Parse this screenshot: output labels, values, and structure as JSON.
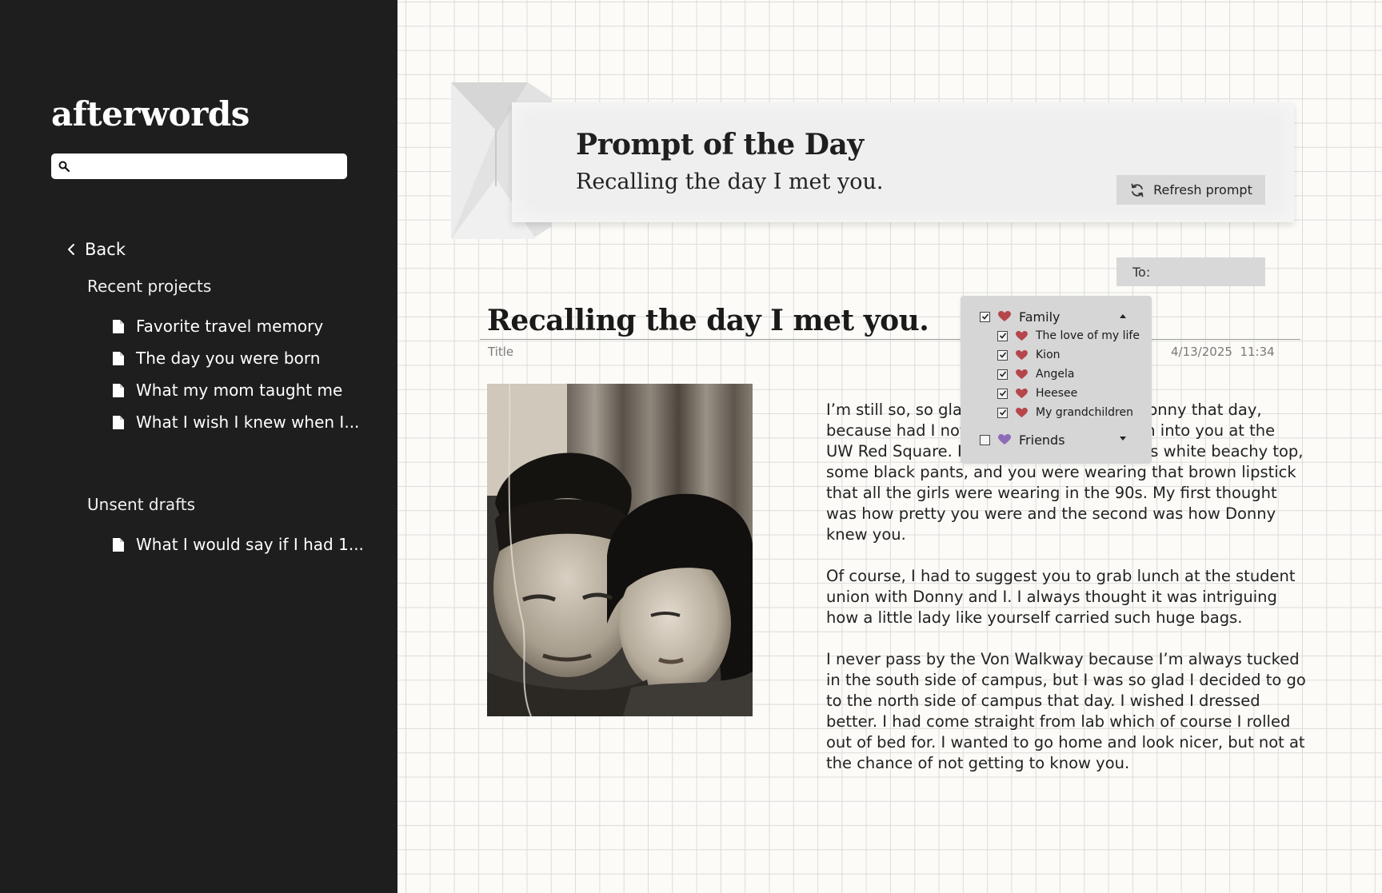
{
  "app": {
    "name": "afterwords"
  },
  "sidebar": {
    "search_placeholder": "",
    "back_label": "Back",
    "recent_label": "Recent projects",
    "recent_items": [
      {
        "label": "Favorite travel memory"
      },
      {
        "label": "The day you were born"
      },
      {
        "label": "What my mom taught me"
      },
      {
        "label": "What I wish I knew when I..."
      }
    ],
    "drafts_label": "Unsent drafts",
    "draft_items": [
      {
        "label": "What I would say if I had 1..."
      }
    ]
  },
  "prompt": {
    "heading": "Prompt of the Day",
    "text": "Recalling the day I met you.",
    "refresh_label": "Refresh prompt",
    "refresh_icon": "refresh-icon"
  },
  "recipient_field": {
    "label": "To:"
  },
  "recipients": {
    "groups": [
      {
        "name": "Family",
        "checked": true,
        "expanded": true,
        "heart_color": "#b5464b",
        "members": [
          {
            "name": "The love of my life",
            "checked": true
          },
          {
            "name": "Kion",
            "checked": true
          },
          {
            "name": "Angela",
            "checked": true
          },
          {
            "name": "Heesee",
            "checked": true
          },
          {
            "name": "My grandchildren",
            "checked": true
          }
        ]
      },
      {
        "name": "Friends",
        "checked": false,
        "expanded": false,
        "heart_color": "#8d6bb8",
        "members": []
      }
    ]
  },
  "document": {
    "title": "Recalling the day I met you.",
    "title_label": "Title",
    "date": "4/13/2025",
    "time": "11:34",
    "paragraphs": [
      "I’m still so, so glad I went to lunch with Donny that day, because had I not, I would have never ran into you at the UW Red Square. I remember you wore this white beachy top, some black pants, and you were wearing that brown lipstick that all the girls were wearing in the 90s. My first thought was how pretty you were and the second was how Donny knew you.",
      "Of course, I had to suggest you to grab lunch at the student union with Donny and I. I always thought it was intriguing how a little lady like yourself carried such huge bags.",
      "I never pass by the Von Walkway because I’m always tucked in the south side of campus, but I was so glad I decided to go to the north side of campus that day. I wished I dressed better. I had come straight from lab which of course I rolled out of bed for. I wanted to go home and look nicer, but not at the chance of not getting to know you."
    ]
  },
  "colors": {
    "sidebar_bg": "#1e1e1e",
    "canvas_bg": "#fcfbf7",
    "button_bg": "#d8d8d8",
    "family_heart": "#b5464b",
    "friends_heart": "#8d6bb8"
  }
}
